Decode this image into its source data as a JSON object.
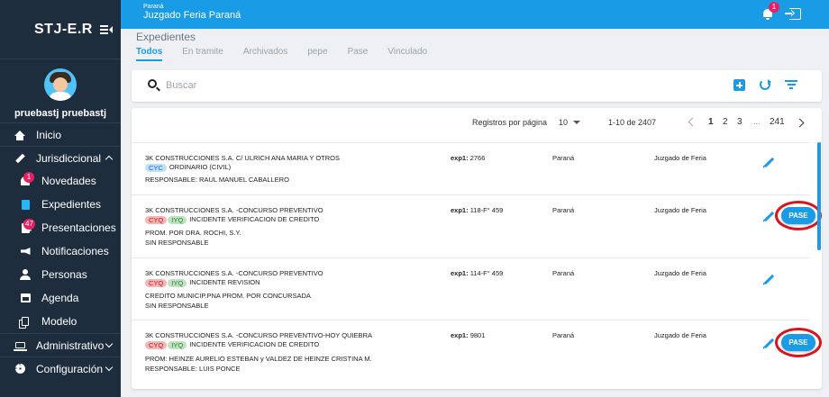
{
  "sidebar": {
    "brand": "STJ-E.R",
    "user_name": "pruebastj pruebastj",
    "items": [
      {
        "label": "Inicio",
        "icon": "home-icon"
      },
      {
        "label": "Jurisdiccional",
        "icon": "gavel-icon"
      },
      {
        "label": "Novedades",
        "icon": "bell-icon",
        "badge": "1"
      },
      {
        "label": "Expedientes",
        "icon": "document-icon"
      },
      {
        "label": "Presentaciones",
        "icon": "documents-icon",
        "badge": "47"
      },
      {
        "label": "Notificaciones",
        "icon": "announcement-icon"
      },
      {
        "label": "Personas",
        "icon": "person-icon"
      },
      {
        "label": "Agenda",
        "icon": "calendar-icon"
      },
      {
        "label": "Modelo",
        "icon": "copy-icon"
      },
      {
        "label": "Administrativo",
        "icon": "laptop-icon"
      },
      {
        "label": "Configuración",
        "icon": "gear-icon"
      }
    ]
  },
  "topbar": {
    "region": "Paraná",
    "title": "Juzgado Feria Paraná",
    "notif_badge": "1"
  },
  "page": {
    "title": "Expedientes",
    "tabs": [
      "Todos",
      "En tramite",
      "Archivados",
      "pepe",
      "Pase",
      "Vinculado"
    ]
  },
  "search": {
    "placeholder": "Buscar"
  },
  "pager": {
    "label": "Registros por página",
    "size": "10",
    "range": "1-10 de 2407",
    "pages": [
      "1",
      "2",
      "3"
    ],
    "dots": "...",
    "last": "241"
  },
  "rows": [
    {
      "title": "3K CONSTRUCCIONES S.A. C/ ULRICH ANA MARIA Y OTROS",
      "tags": [
        {
          "text": "CYC",
          "color": "blue"
        }
      ],
      "type": "ORDINARIO (CIVIL)",
      "extra1": "RESPONSABLE: RAUL MANUEL CABALLERO",
      "extra2": "",
      "exp_label": "exp1:",
      "exp_value": "2766",
      "city": "Paraná",
      "court": "Juzgado de Feria",
      "pase": ""
    },
    {
      "title": "3K CONSTRUCCIONES S.A. -CONCURSO PREVENTIVO",
      "tags": [
        {
          "text": "CYQ",
          "color": "red"
        },
        {
          "text": "IYQ",
          "color": "green"
        }
      ],
      "type": "INCIDENTE VERIFICACION DE CREDITO",
      "extra1": "PROM. POR DRA. ROCHI, S.Y.",
      "extra2": "SIN RESPONSABLE",
      "exp_label": "exp1:",
      "exp_value": "118-F° 459",
      "city": "Paraná",
      "court": "Juzgado de Feria",
      "pase": "PASE"
    },
    {
      "title": "3K CONSTRUCCIONES S.A. -CONCURSO PREVENTIVO",
      "tags": [
        {
          "text": "CYQ",
          "color": "red"
        },
        {
          "text": "IYQ",
          "color": "green"
        }
      ],
      "type": "INCIDENTE REVISION",
      "extra1": "CREDITO MUNICIP.PNA PROM. POR CONCURSADA",
      "extra2": "SIN RESPONSABLE",
      "exp_label": "exp1:",
      "exp_value": "114-F° 459",
      "city": "Paraná",
      "court": "Juzgado de Feria",
      "pase": ""
    },
    {
      "title": "3K CONSTRUCCIONES S.A. -CONCURSO PREVENTIVO-HOY QUIEBRA",
      "tags": [
        {
          "text": "CYQ",
          "color": "red"
        },
        {
          "text": "IYQ",
          "color": "green"
        }
      ],
      "type": "INCIDENTE VERIFICACION DE CREDITO",
      "extra1": "PROM: HEINZE AURELIO ESTEBAN y VALDEZ DE HEINZE CRISTINA M.",
      "extra2": "RESPONSABLE: LUIS PONCE",
      "exp_label": "exp1:",
      "exp_value": "9801",
      "city": "Paraná",
      "court": "Juzgado de Feria",
      "pase": "PASE"
    }
  ],
  "colors": {
    "sidebar_bg": "#1e2d3d",
    "accent": "#1a9be6",
    "badge": "#e91e63",
    "highlight_ring": "#d9141c"
  }
}
